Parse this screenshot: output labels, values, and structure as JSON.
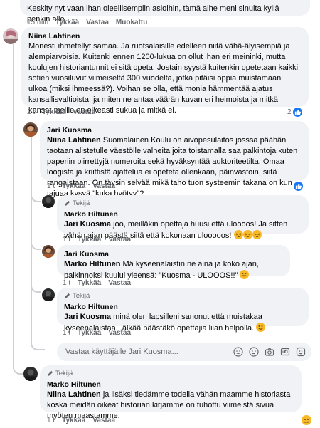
{
  "top_comment": {
    "text": "Keskity nyt vaan ihan oleellisempiin asioihin, tämä aihe meni sinulta kyllä penkin alle..",
    "time": "15 min",
    "like": "Tykkää",
    "reply": "Vastaa",
    "edited": "Muokattu"
  },
  "c1": {
    "author": "Niina Lahtinen",
    "text": "Monesti ihmetellyt samaa. Ja ruotsalaisille edelleen niitä vähä-älyisempiä ja alempiarvoisia. Kuitenki ennen 1200-lukua on ollut ihan eri meininki, mutta koulujen historiantunnit ei sitä opeta. Jostain syystä kuitenkin opetetaan kaikki sotien vuosiluvut viimeiseltä 300 vuodelta, jotka pitäisi oppia muistamaan ulkoa (miksi ihmeessä?). Voihan se olla, että monia hämmentää ajatus kansallisvaltioista, ja miten ne antaa väärän kuvan eri heimoista ja mitkä kansat meille on oikeasti sukua ja mitkä ei.",
    "time": "2 t",
    "like": "Tykkää",
    "reply": "Vastaa",
    "reaction_count": "2"
  },
  "c2": {
    "author": "Jari Kuosma",
    "mention": "Niina Lahtinen",
    "text": " Suomalainen Koulu on aivopesulaitos josssa päähän taotaan alistetulle väestölle valheita joita toistamalla saa palkintoja kuten paperiin piirrettyjä numeroita sekä hyväksyntää auktoriteetilta. Omaa loogista ja kriittistä ajattelua ei opeteta ollenkaan, päinvastoin, siitä rangaistaan. On täysin selvää mikä taho tuon systeemin takana on kun tajuaa kysyä \"kuka hyötyy\"?",
    "time": "1 t",
    "like": "Tykkää",
    "reply": "Vastaa"
  },
  "c3": {
    "badge": "Tekijä",
    "author": "Marko Hiltunen",
    "mention": "Jari Kuosma",
    "text": " joo, meilläkin opettaja huusi että uloooos! Ja sitten vähän ajan päästä siitä että kokonaan ulooooos!",
    "emojis": [
      "laugh",
      "laugh",
      "laugh"
    ],
    "time": "1 t",
    "like": "Tykkää",
    "reply": "Vastaa"
  },
  "c4": {
    "author": "Jari Kuosma",
    "mention": "Marko Hiltunen",
    "text": " Mä kyseenalaistin ne aina ja koko ajan, palkinnoksi kuului yleensä: \"Kuosma - ULOOOS!!\"",
    "emojis": [
      "grin"
    ],
    "time": "1 t",
    "like": "Tykkää",
    "reply": "Vastaa"
  },
  "c5": {
    "badge": "Tekijä",
    "author": "Marko Hiltunen",
    "mention": "Jari Kuosma",
    "text": " minä olen lapsilleni sanonut että muistakaa kyseenalaistaa...älkää päästäkö opettajia liian helpolla.",
    "emojis": [
      "smile"
    ],
    "time": "1 t",
    "like": "Tykkää",
    "reply": "Vastaa"
  },
  "reply_box": {
    "placeholder": "Vastaa käyttäjälle Jari Kuosma...",
    "icons": [
      "emoji-icon",
      "sticker-icon",
      "camera-icon",
      "gif-icon",
      "avatar-sticker-icon"
    ]
  },
  "c6": {
    "badge": "Tekijä",
    "author": "Marko Hiltunen",
    "mention": "Niina Lahtinen",
    "text": " ja lisäksi tiedämme todella vähän maamme historiasta koska meidän oikeat historian kirjamme on tuhottu viimeistä sivua myöten maastamme.",
    "time": "1 t",
    "like": "Tykkää",
    "reply": "Vastaa",
    "reaction": "sad"
  }
}
